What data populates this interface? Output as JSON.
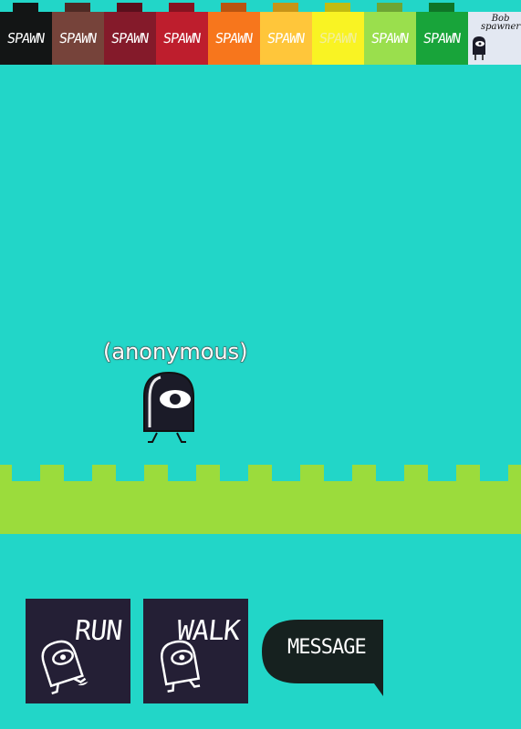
{
  "toolbar": {
    "spawn_buttons": [
      {
        "label": "SPAWN",
        "color": "#131515",
        "tab": "#131515"
      },
      {
        "label": "SPAWN",
        "color": "#76433a",
        "tab": "#4e2a24"
      },
      {
        "label": "SPAWN",
        "color": "#841a2a",
        "tab": "#5a0f1c"
      },
      {
        "label": "SPAWN",
        "color": "#be1e2d",
        "tab": "#861320"
      },
      {
        "label": "SPAWN",
        "color": "#f7761c",
        "tab": "#b85410"
      },
      {
        "label": "SPAWN",
        "color": "#ffc63a",
        "tab": "#c79418"
      },
      {
        "label": "SPAWN",
        "color": "#f9f323",
        "tab": "#c2bb12"
      },
      {
        "label": "SPAWN",
        "color": "#9adf4d",
        "tab": "#6ea534"
      },
      {
        "label": "SPAWN",
        "color": "#18a43a",
        "tab": "#0f7527"
      }
    ],
    "bob_spawner": {
      "line1": "Bob",
      "line2": "spawner",
      "color": "#e3e8f2"
    }
  },
  "scene": {
    "sky_color": "#22d6c8",
    "ground_color": "#9bdc3c",
    "player_name": "(anonymous)"
  },
  "controls": {
    "run_label": "RUN",
    "walk_label": "WALK",
    "message_label": "MESSAGE"
  }
}
